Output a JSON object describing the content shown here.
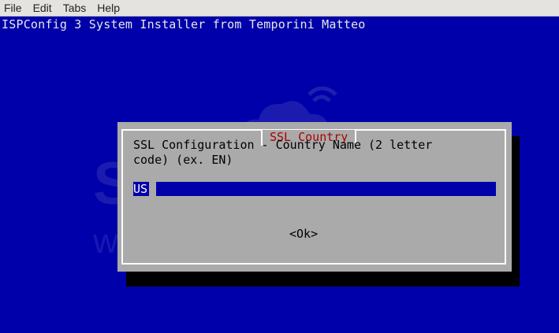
{
  "menubar": {
    "items": [
      "File",
      "Edit",
      "Tabs",
      "Help"
    ]
  },
  "terminal": {
    "title": "ISPConfig 3 System Installer from Temporini Matteo"
  },
  "watermark": {
    "brand": "SCCU",
    "sub": "web hosting"
  },
  "dialog": {
    "title": "SSL Country",
    "text": "SSL Configuration - Country Name (2 letter\ncode) (ex. EN)",
    "input_value": "US",
    "ok_label": "<Ok>"
  },
  "colors": {
    "background": "#0000aa",
    "dialog": "#aaaaaa",
    "title_text": "#aa0000",
    "input_bg": "#0000aa"
  }
}
